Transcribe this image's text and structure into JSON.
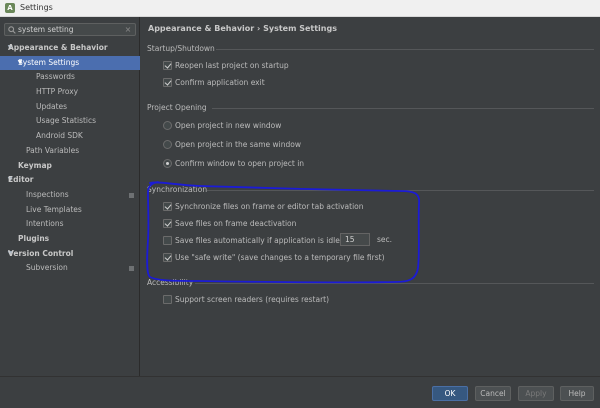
{
  "window": {
    "title": "Settings"
  },
  "search": {
    "value": "system setting"
  },
  "tree": [
    {
      "label": "Appearance & Behavior",
      "bold": true,
      "arrow": "▼"
    },
    {
      "label": "System Settings",
      "selected": true,
      "arrow": "▼"
    },
    {
      "label": "Passwords"
    },
    {
      "label": "HTTP Proxy"
    },
    {
      "label": "Updates"
    },
    {
      "label": "Usage Statistics"
    },
    {
      "label": "Android SDK"
    },
    {
      "label": "Path Variables"
    },
    {
      "label": "Keymap",
      "bold": true
    },
    {
      "label": "Editor",
      "bold": true,
      "arrow": "▼"
    },
    {
      "label": "Inspections",
      "square": true
    },
    {
      "label": "Live Templates"
    },
    {
      "label": "Intentions"
    },
    {
      "label": "Plugins",
      "bold": true
    },
    {
      "label": "Version Control",
      "bold": true,
      "arrow": "▼"
    },
    {
      "label": "Subversion",
      "square": true
    }
  ],
  "main": {
    "breadcrumb": "Appearance & Behavior › System Settings",
    "startup": {
      "title": "Startup/Shutdown",
      "reopen": {
        "label": "Reopen last project on startup",
        "checked": true
      },
      "confirm_exit": {
        "label": "Confirm application exit",
        "checked": true
      }
    },
    "project_opening": {
      "title": "Project Opening",
      "new_window": {
        "label": "Open project in new window",
        "selected": false
      },
      "same_window": {
        "label": "Open project in the same window",
        "selected": false
      },
      "confirm_window": {
        "label": "Confirm window to open project in",
        "selected": true
      }
    },
    "sync": {
      "title": "Synchronization",
      "frame_activation": {
        "label": "Synchronize files on frame or editor tab activation",
        "checked": true
      },
      "frame_deactivation": {
        "label": "Save files on frame deactivation",
        "checked": true
      },
      "auto_save": {
        "label": "Save files automatically if application is idle for",
        "checked": false,
        "value": "15",
        "unit": "sec."
      },
      "safe_write": {
        "label": "Use \"safe write\" (save changes to a temporary file first)",
        "checked": true
      }
    },
    "accessibility": {
      "title": "Accessibility",
      "screen_readers": {
        "label": "Support screen readers (requires restart)",
        "checked": false
      }
    }
  },
  "buttons": {
    "ok": "OK",
    "cancel": "Cancel",
    "apply": "Apply",
    "help": "Help"
  },
  "colors": {
    "selection": "#4b6eaf",
    "annotation": "#1b1bd6",
    "primary_button": "#365880"
  }
}
